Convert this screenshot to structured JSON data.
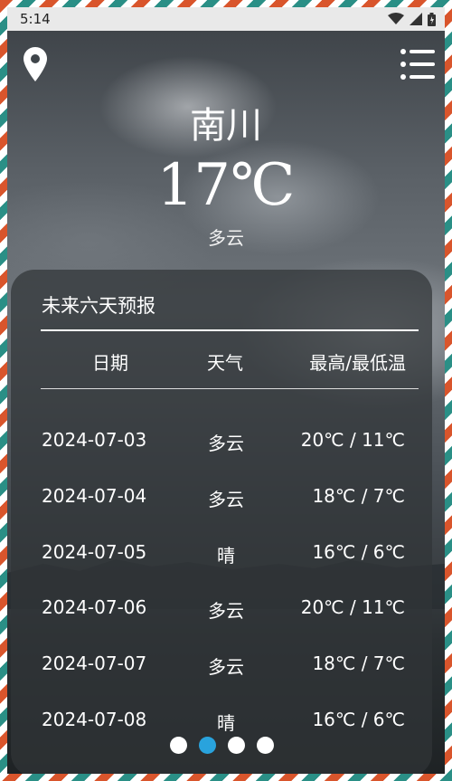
{
  "status_bar": {
    "time": "5:14"
  },
  "location": {
    "city": "南川",
    "temperature": "17℃",
    "condition": "多云"
  },
  "forecast": {
    "title": "未来六天预报",
    "headers": {
      "date": "日期",
      "weather": "天气",
      "temp": "最高/最低温"
    },
    "rows": [
      {
        "date": "2024-07-03",
        "weather": "多云",
        "temp": "20℃ / 11℃"
      },
      {
        "date": "2024-07-04",
        "weather": "多云",
        "temp": "18℃ / 7℃"
      },
      {
        "date": "2024-07-05",
        "weather": "晴",
        "temp": "16℃ / 6℃"
      },
      {
        "date": "2024-07-06",
        "weather": "多云",
        "temp": "20℃ / 11℃"
      },
      {
        "date": "2024-07-07",
        "weather": "多云",
        "temp": "18℃ / 7℃"
      },
      {
        "date": "2024-07-08",
        "weather": "晴",
        "temp": "16℃ / 6℃"
      }
    ]
  },
  "pager": {
    "count": 4,
    "active_index": 1,
    "active_color": "#29a3dd"
  },
  "icons": [
    "location-pin-icon",
    "menu-icon",
    "wifi-icon",
    "signal-icon",
    "battery-icon"
  ]
}
